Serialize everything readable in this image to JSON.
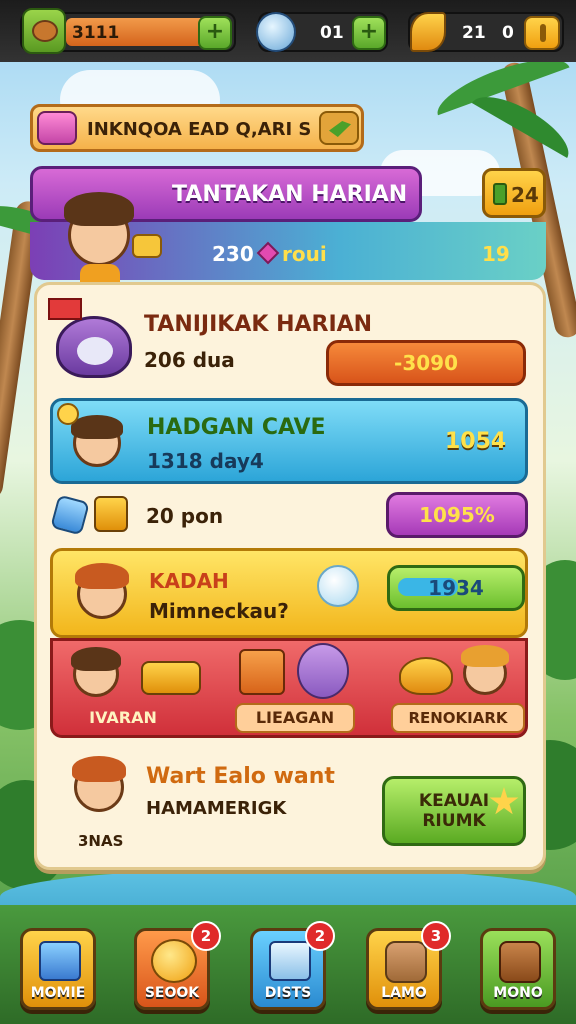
{
  "top_bar": {
    "res1_value": "3111",
    "res2_value": "01",
    "res3_value": "21",
    "res3_value2": "0"
  },
  "banner": {
    "title": "INKNQOA EAD Q,ARI S"
  },
  "header_card": {
    "title": "TANTAKAN HARIAN",
    "badge": "24",
    "sub_value": "230",
    "sub_label": "roui",
    "right_value": "19"
  },
  "tasks": [
    {
      "title": "TANIJIKAK HARIAN",
      "sub": "206 dua",
      "value": "-3090"
    },
    {
      "title": "HADGAN CAVE",
      "sub": "1318 day4",
      "value": "1054"
    },
    {
      "sub": "20 pon",
      "value": "1095%"
    },
    {
      "title": "KADAH",
      "sub": "Mimneckau?",
      "value": "1934"
    }
  ],
  "reward_strip": {
    "items": [
      "IVARAN",
      "LIEAGAN",
      "RENOKIARK"
    ]
  },
  "bottom_card": {
    "title": "Wart Ealo want",
    "sub": "HAMAMERIGK",
    "avatar_label": "3NAS",
    "button_line1": "KEAUAI",
    "button_line2": "RIUMK"
  },
  "nav": [
    {
      "label": "MOMIE"
    },
    {
      "label": "SEOOK",
      "badge": "2"
    },
    {
      "label": "DISTS",
      "badge": "2"
    },
    {
      "label": "LAMO",
      "badge": "3"
    },
    {
      "label": "MONO"
    }
  ],
  "colors": {
    "orange": "#f07a1e",
    "cyan": "#3bb6e6",
    "purple": "#b54bc7",
    "yellow": "#f6cf2e",
    "red": "#dd3b3b",
    "green": "#6dbf2e"
  }
}
